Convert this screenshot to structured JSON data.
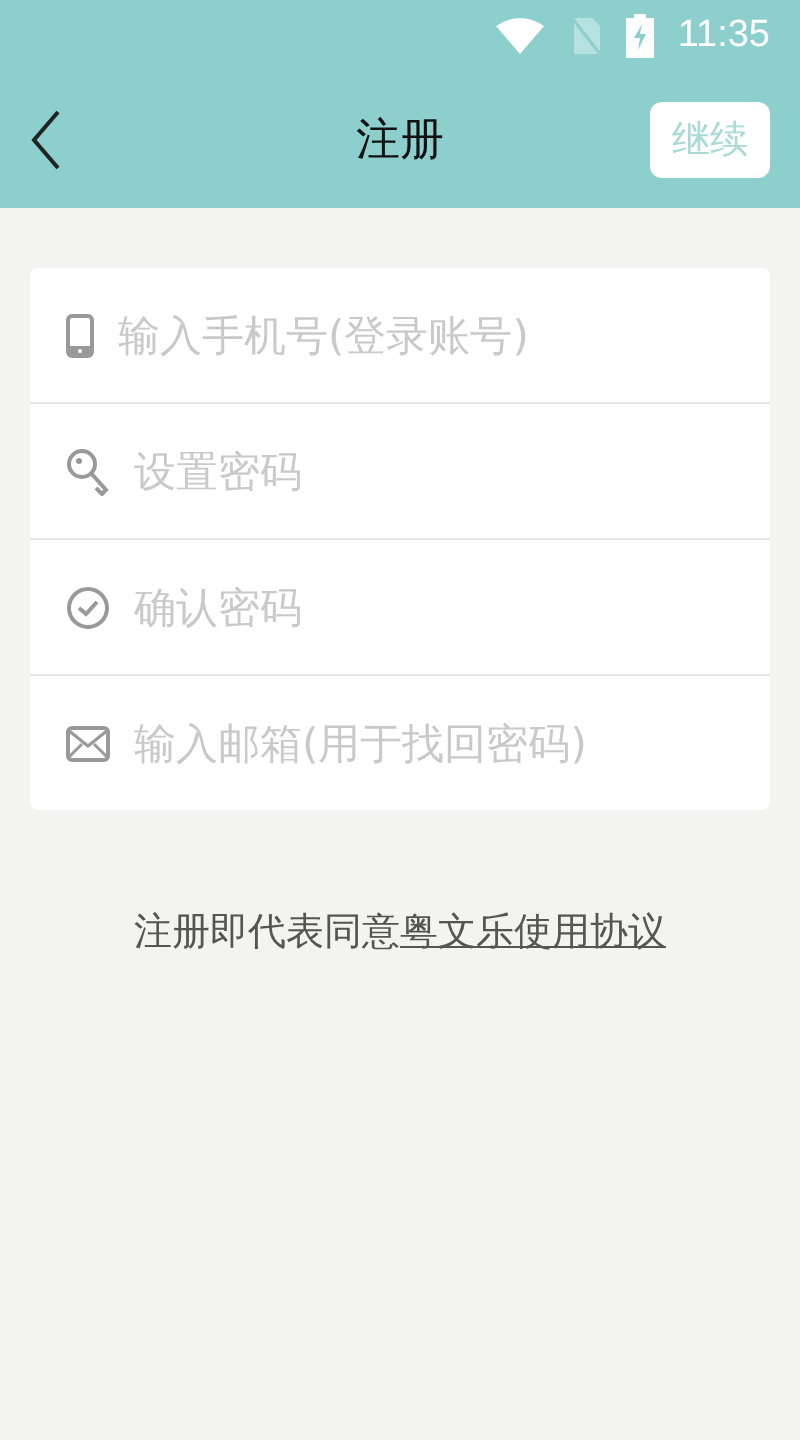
{
  "status_bar": {
    "time": "11:35"
  },
  "header": {
    "title": "注册",
    "action": "继续"
  },
  "fields": [
    {
      "kind": "phone",
      "placeholder": "输入手机号(登录账号)"
    },
    {
      "kind": "key",
      "placeholder": "设置密码"
    },
    {
      "kind": "check",
      "placeholder": "确认密码"
    },
    {
      "kind": "mail",
      "placeholder": "输入邮箱(用于找回密码)"
    }
  ],
  "agreement": {
    "text": "注册即代表同意",
    "link": "粤文乐使用协议"
  }
}
